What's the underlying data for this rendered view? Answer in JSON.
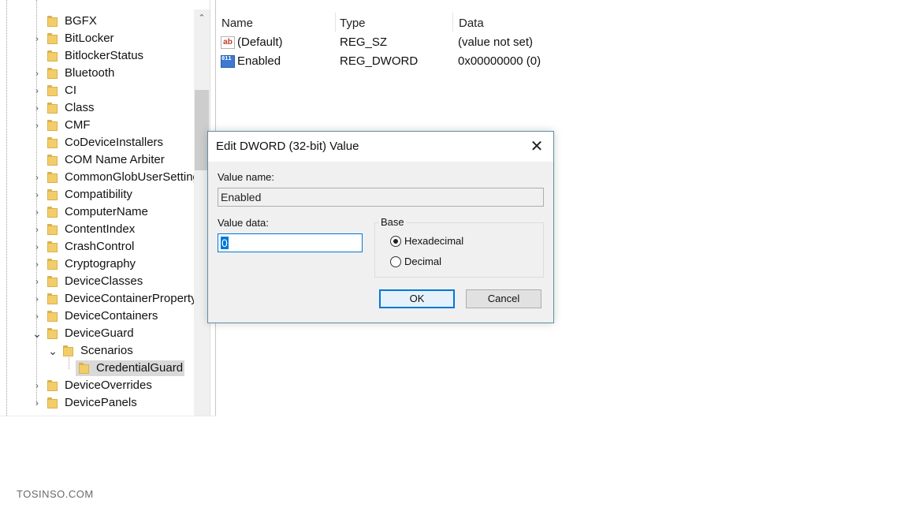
{
  "tree": {
    "items": [
      {
        "label": "BGFX",
        "expander": ""
      },
      {
        "label": "BitLocker",
        "expander": "›"
      },
      {
        "label": "BitlockerStatus",
        "expander": ""
      },
      {
        "label": "Bluetooth",
        "expander": "›"
      },
      {
        "label": "CI",
        "expander": "›"
      },
      {
        "label": "Class",
        "expander": "›"
      },
      {
        "label": "CMF",
        "expander": "›"
      },
      {
        "label": "CoDeviceInstallers",
        "expander": ""
      },
      {
        "label": "COM Name Arbiter",
        "expander": ""
      },
      {
        "label": "CommonGlobUserSettings",
        "expander": "›"
      },
      {
        "label": "Compatibility",
        "expander": "›"
      },
      {
        "label": "ComputerName",
        "expander": "›"
      },
      {
        "label": "ContentIndex",
        "expander": "›"
      },
      {
        "label": "CrashControl",
        "expander": "›"
      },
      {
        "label": "Cryptography",
        "expander": "›"
      },
      {
        "label": "DeviceClasses",
        "expander": "›"
      },
      {
        "label": "DeviceContainerPropertyUpdateEvents",
        "expander": "›"
      },
      {
        "label": "DeviceContainers",
        "expander": "›"
      },
      {
        "label": "DeviceGuard",
        "expander": "⌄"
      },
      {
        "label": "Scenarios",
        "expander": "⌄"
      },
      {
        "label": "CredentialGuard",
        "expander": ""
      },
      {
        "label": "DeviceOverrides",
        "expander": "›"
      },
      {
        "label": "DevicePanels",
        "expander": "›"
      }
    ],
    "selected": "CredentialGuard",
    "scroll_up_glyph": "⌃"
  },
  "list": {
    "columns": {
      "name": "Name",
      "type": "Type",
      "data": "Data"
    },
    "rows": [
      {
        "icon": "string-value-icon",
        "icon_text": "ab",
        "name": "(Default)",
        "type": "REG_SZ",
        "data": "(value not set)"
      },
      {
        "icon": "binary-value-icon",
        "icon_text": "011 110",
        "name": "Enabled",
        "type": "REG_DWORD",
        "data": "0x00000000 (0)"
      }
    ]
  },
  "dialog": {
    "title": "Edit DWORD (32-bit) Value",
    "close_glyph": "✕",
    "value_name_label": "Value name:",
    "value_name": "Enabled",
    "value_data_label": "Value data:",
    "value_data": "0",
    "base_label": "Base",
    "base_options": [
      {
        "label": "Hexadecimal",
        "selected": true
      },
      {
        "label": "Decimal",
        "selected": false
      }
    ],
    "ok_label": "OK",
    "cancel_label": "Cancel"
  },
  "watermark": "TOSINSO.COM"
}
